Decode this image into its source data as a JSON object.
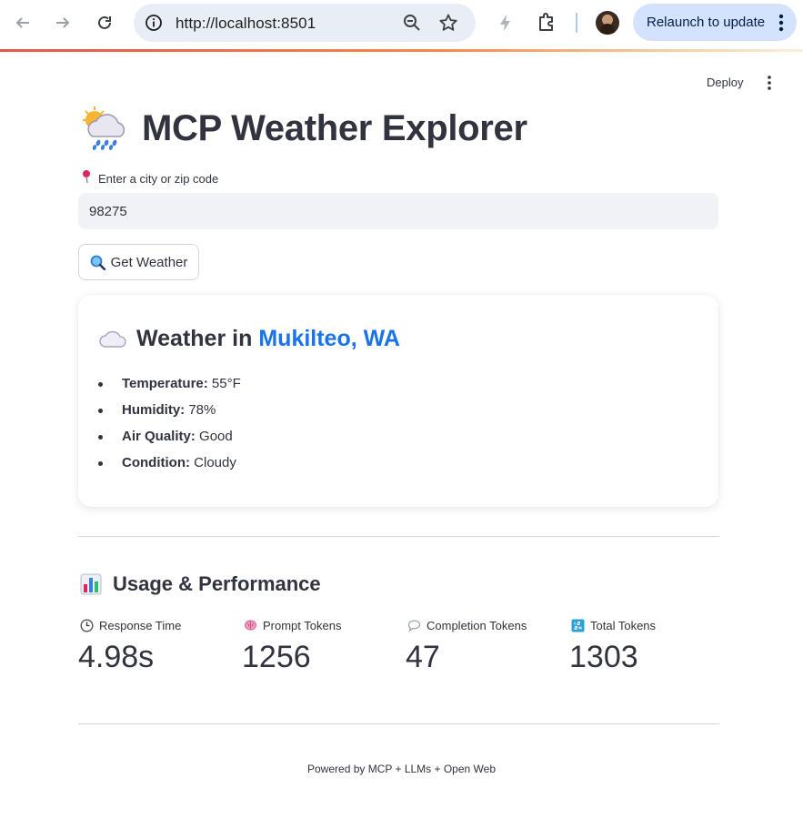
{
  "browser": {
    "url": "http://localhost:8501",
    "relaunch_label": "Relaunch to update",
    "accent_colors": [
      "#e2584a",
      "#f08a4b",
      "#f6d2a6"
    ]
  },
  "app": {
    "deploy_label": "Deploy",
    "title": "MCP Weather Explorer",
    "title_icon": "sun-behind-rain-cloud-emoji",
    "input": {
      "label": "Enter a city or zip code",
      "label_icon": "round-pushpin-icon",
      "value": "98275"
    },
    "button": {
      "label": "Get Weather",
      "icon": "magnifying-glass-icon"
    },
    "weather": {
      "heading_prefix": "Weather in",
      "city": "Mukilteo, WA",
      "city_color": "#1a73e8",
      "icon": "cloud-icon",
      "stats": [
        {
          "label": "Temperature:",
          "value": "55°F"
        },
        {
          "label": "Humidity:",
          "value": "78%"
        },
        {
          "label": "Air Quality:",
          "value": "Good"
        },
        {
          "label": "Condition:",
          "value": "Cloudy"
        }
      ]
    },
    "usage": {
      "title": "Usage & Performance",
      "icon": "bar-chart-icon",
      "metrics": [
        {
          "label": "Response Time",
          "value": "4.98s",
          "icon": "clock-icon"
        },
        {
          "label": "Prompt Tokens",
          "value": "1256",
          "icon": "brain-icon"
        },
        {
          "label": "Completion Tokens",
          "value": "47",
          "icon": "speech-bubble-icon"
        },
        {
          "label": "Total Tokens",
          "value": "1303",
          "icon": "numbers-icon"
        }
      ]
    },
    "footer": "Powered by MCP + LLMs + Open Web"
  }
}
